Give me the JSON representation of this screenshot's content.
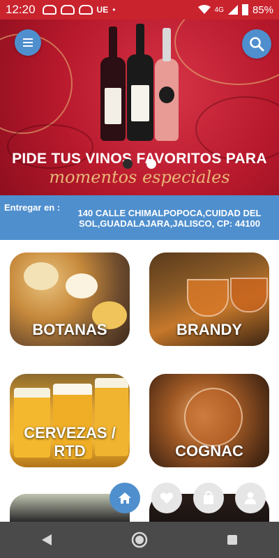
{
  "status_bar": {
    "time": "12:20",
    "carrier_badge": "UE",
    "network": "4G",
    "battery": "85%",
    "icons": [
      "notification-icon",
      "notification-icon",
      "notification-icon",
      "dot-icon",
      "wifi-icon",
      "signal-icon",
      "battery-icon"
    ]
  },
  "banner": {
    "headline": "PIDE TUS VINOS FAVORITOS PARA",
    "subline": "momentos especiales",
    "slides_total": 2,
    "active_slide": 2
  },
  "header": {
    "menu_icon": "menu-icon",
    "search_icon": "search-icon"
  },
  "delivery": {
    "label": "Entregar en :",
    "address": "140 CALLE CHIMALPOPOCA,CUIDAD DEL SOL,GUADALAJARA,JALISCO, CP: 44100"
  },
  "categories": [
    {
      "name": "BOTANAS"
    },
    {
      "name": "BRANDY"
    },
    {
      "name": "CERVEZAS / RTD"
    },
    {
      "name": "COGNAC"
    }
  ],
  "bottom_nav": {
    "items": [
      "home-icon",
      "heart-icon",
      "bag-icon",
      "profile-icon"
    ],
    "active": "home-icon"
  },
  "system_nav": [
    "back-icon",
    "home-circle-icon",
    "recents-icon"
  ],
  "colors": {
    "accent": "#4f8fce",
    "banner_red": "#b8192c",
    "status_bar": "#c9232e",
    "system_nav": "#4a4a4a"
  }
}
